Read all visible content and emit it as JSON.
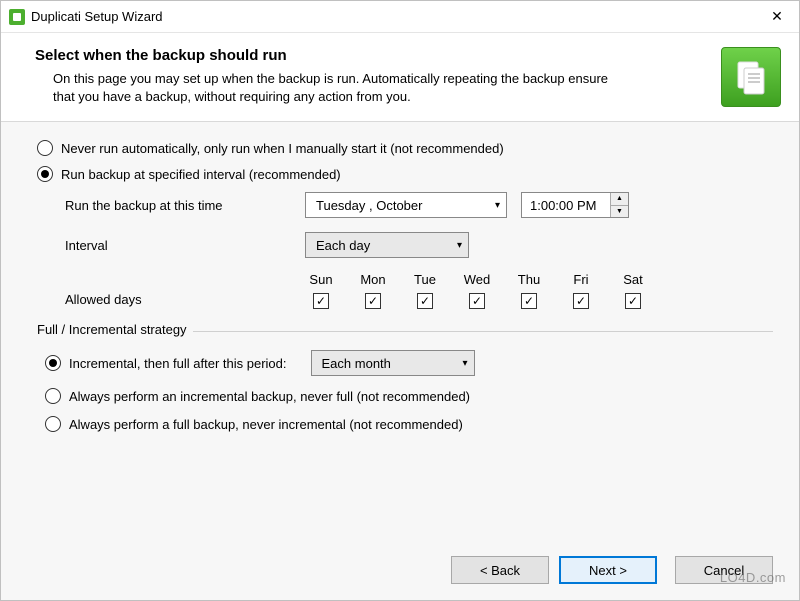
{
  "window": {
    "title": "Duplicati Setup Wizard"
  },
  "header": {
    "heading": "Select when the backup should run",
    "sub": "On this page you may set up when the backup is run. Automatically repeating the backup ensure that you have a backup, without requiring any action from you."
  },
  "schedule": {
    "never_label": "Never run automatically, only run when I manually start it (not recommended)",
    "interval_label": "Run backup at specified interval (recommended)",
    "run_time_label": "Run the backup at this time",
    "date_value": "Tuesday   ,   October",
    "time_value": "1:00:00 PM",
    "interval_row_label": "Interval",
    "interval_value": "Each day",
    "allowed_days_label": "Allowed days",
    "days": [
      "Sun",
      "Mon",
      "Tue",
      "Wed",
      "Thu",
      "Fri",
      "Sat"
    ]
  },
  "strategy": {
    "legend": "Full / Incremental strategy",
    "opt_incremental_label": "Incremental, then full after this period:",
    "period_value": "Each month",
    "opt_always_incremental": "Always perform an incremental backup, never full (not recommended)",
    "opt_always_full": "Always perform a full backup, never incremental (not recommended)"
  },
  "buttons": {
    "back": "< Back",
    "next": "Next >",
    "cancel": "Cancel"
  },
  "watermark": "LO4D.com"
}
